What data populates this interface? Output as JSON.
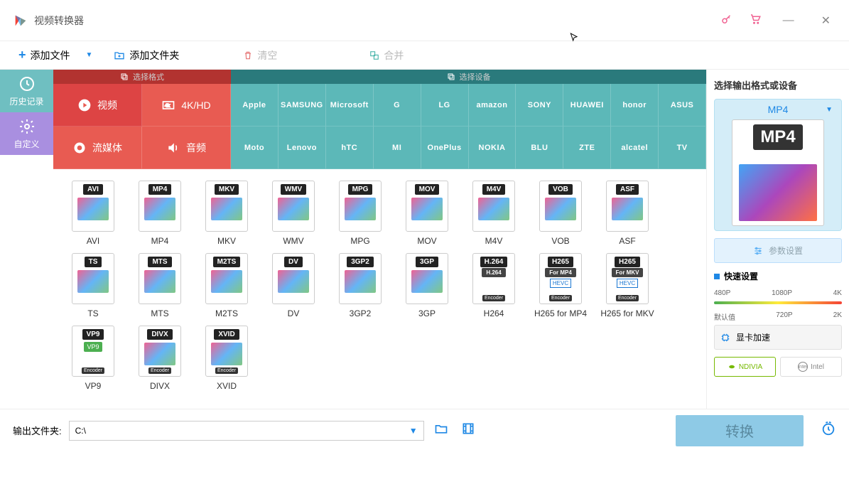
{
  "app": {
    "title": "视频转换器"
  },
  "toolbar": {
    "add_file": "添加文件",
    "add_folder": "添加文件夹",
    "clear": "清空",
    "merge": "合并"
  },
  "sidebar": {
    "history": "历史记录",
    "custom": "自定义"
  },
  "category_header": {
    "format": "选择格式",
    "device": "选择设备"
  },
  "types": {
    "video": "视频",
    "hd": "4K/HD",
    "stream": "流媒体",
    "audio": "音频"
  },
  "brands_row1": [
    "Apple",
    "SAMSUNG",
    "Microsoft",
    "G",
    "LG",
    "amazon",
    "SONY",
    "HUAWEI",
    "honor",
    "ASUS"
  ],
  "brands_row2": [
    "Moto",
    "Lenovo",
    "hTC",
    "MI",
    "OnePlus",
    "NOKIA",
    "BLU",
    "ZTE",
    "alcatel",
    "TV"
  ],
  "formats": [
    {
      "badge": "AVI",
      "label": "AVI"
    },
    {
      "badge": "MP4",
      "label": "MP4"
    },
    {
      "badge": "MKV",
      "label": "MKV"
    },
    {
      "badge": "WMV",
      "label": "WMV"
    },
    {
      "badge": "MPG",
      "label": "MPG"
    },
    {
      "badge": "MOV",
      "label": "MOV"
    },
    {
      "badge": "M4V",
      "label": "M4V"
    },
    {
      "badge": "VOB",
      "label": "VOB"
    },
    {
      "badge": "ASF",
      "label": "ASF"
    },
    {
      "badge": "TS",
      "label": "TS"
    },
    {
      "badge": "MTS",
      "label": "MTS"
    },
    {
      "badge": "M2TS",
      "label": "M2TS"
    },
    {
      "badge": "DV",
      "label": "DV"
    },
    {
      "badge": "3GP2",
      "label": "3GP2"
    },
    {
      "badge": "3GP",
      "label": "3GP"
    },
    {
      "badge": "H.264",
      "sub": "H.264",
      "enc": "Encoder",
      "label": "H264"
    },
    {
      "badge": "H265",
      "sub": "For MP4",
      "hevc": "HEVC",
      "enc": "Encoder",
      "label": "H265 for MP4"
    },
    {
      "badge": "H265",
      "sub": "For MKV",
      "hevc": "HEVC",
      "enc": "Encoder",
      "label": "H265 for MKV"
    },
    {
      "badge": "VP9",
      "vp": "VP9",
      "enc": "Encoder",
      "label": "VP9"
    },
    {
      "badge": "DIVX",
      "enc": "Encoder",
      "label": "DIVX"
    },
    {
      "badge": "XVID",
      "enc": "Encoder",
      "label": "XVID"
    }
  ],
  "right": {
    "title": "选择输出格式或设备",
    "selected": "MP4",
    "preview_label": "MP4",
    "param": "参数设置",
    "quick": "快速设置",
    "res_top": [
      "480P",
      "1080P",
      "4K"
    ],
    "res_bottom": [
      "默认值",
      "720P",
      "2K"
    ],
    "gpu": "显卡加速",
    "nvidia": "NDIVIA",
    "intel": "Intel"
  },
  "footer": {
    "out_label": "输出文件夹:",
    "out_path": "C:\\",
    "convert": "转换"
  }
}
